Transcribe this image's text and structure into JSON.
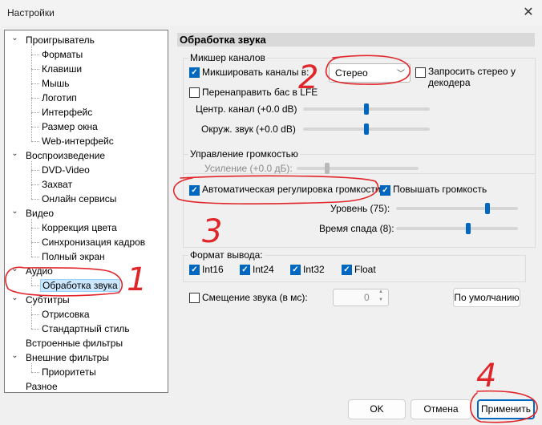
{
  "window": {
    "title": "Настройки",
    "close_glyph": "✕"
  },
  "tree": {
    "items": [
      {
        "label": "Проигрыватель",
        "level": 0,
        "expanded": true
      },
      {
        "label": "Форматы",
        "level": 1
      },
      {
        "label": "Клавиши",
        "level": 1
      },
      {
        "label": "Мышь",
        "level": 1
      },
      {
        "label": "Логотип",
        "level": 1
      },
      {
        "label": "Интерфейс",
        "level": 1
      },
      {
        "label": "Размер окна",
        "level": 1
      },
      {
        "label": "Web-интерфейс",
        "level": 1
      },
      {
        "label": "Воспроизведение",
        "level": 0,
        "expanded": true
      },
      {
        "label": "DVD-Video",
        "level": 1
      },
      {
        "label": "Захват",
        "level": 1
      },
      {
        "label": "Онлайн сервисы",
        "level": 1
      },
      {
        "label": "Видео",
        "level": 0,
        "expanded": true
      },
      {
        "label": "Коррекция цвета",
        "level": 1
      },
      {
        "label": "Синхронизация кадров",
        "level": 1
      },
      {
        "label": "Полный экран",
        "level": 1
      },
      {
        "label": "Аудио",
        "level": 0,
        "expanded": true
      },
      {
        "label": "Обработка звука",
        "level": 1,
        "selected": true
      },
      {
        "label": "Субтитры",
        "level": 0,
        "expanded": true
      },
      {
        "label": "Отрисовка",
        "level": 1
      },
      {
        "label": "Стандартный стиль",
        "level": 1
      },
      {
        "label": "Встроенные фильтры",
        "level": 0
      },
      {
        "label": "Внешние фильтры",
        "level": 0,
        "expanded": true
      },
      {
        "label": "Приоритеты",
        "level": 1
      },
      {
        "label": "Разное",
        "level": 0
      }
    ]
  },
  "panel": {
    "title": "Обработка звука",
    "mixer": {
      "group_title": "Микшер каналов",
      "mix_label": "Микшировать каналы в:",
      "mix_checked": true,
      "mix_value": "Стерео",
      "request_stereo_label": "Запросить стерео у декодера",
      "request_stereo_checked": false,
      "lfe_label": "Перенаправить бас в LFE",
      "lfe_checked": false,
      "center_label": "Центр. канал (+0.0 dB)",
      "center_level": 0.5,
      "surround_label": "Окруж. звук (+0.0 dB)",
      "surround_level": 0.5
    },
    "volume": {
      "group_title": "Управление громкостью",
      "gain_label": "Усиление (+0.0 дБ):",
      "gain_level": 0.25,
      "agc_label": "Автоматическая регулировка громкости",
      "agc_checked": true,
      "boost_label": "Повышать громкость",
      "boost_checked": true,
      "level_label": "Уровень (75):",
      "level_value": 75,
      "level_fraction": 0.75,
      "release_label": "Время спада (8):",
      "release_value": 8,
      "release_fraction": 0.59
    },
    "format": {
      "group_title": "Формат вывода:",
      "options": [
        {
          "label": "Int16",
          "checked": true
        },
        {
          "label": "Int24",
          "checked": true
        },
        {
          "label": "Int32",
          "checked": true
        },
        {
          "label": "Float",
          "checked": true
        }
      ]
    },
    "offset": {
      "label": "Смещение звука (в мс):",
      "checked": false,
      "value": "0",
      "up": "▲",
      "down": "▼"
    },
    "default_button": "По умолчанию"
  },
  "buttons": {
    "ok": "OK",
    "cancel": "Отмена",
    "apply": "Применить"
  },
  "annotations": {
    "color": "#e0262a",
    "marks": [
      "1",
      "2",
      "3",
      "4"
    ]
  },
  "check_glyph": "✓"
}
